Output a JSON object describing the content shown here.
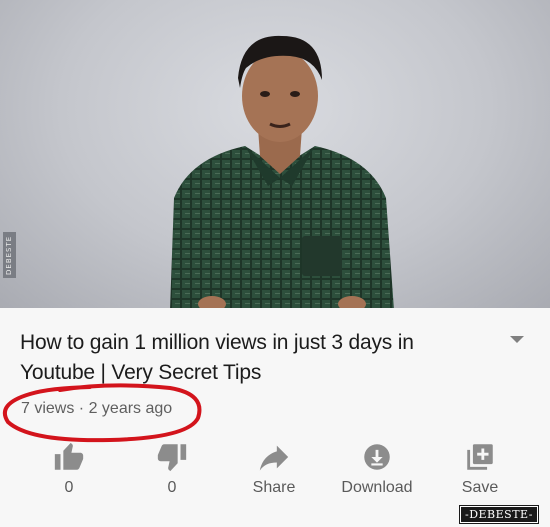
{
  "video": {
    "side_watermark": "DEBESTE"
  },
  "details": {
    "title": "How to gain 1 million views in just 3 days in Youtube | Very Secret Tips",
    "meta": "7 views · 2 years ago"
  },
  "actions": {
    "like_count": "0",
    "dislike_count": "0",
    "share_label": "Share",
    "download_label": "Download",
    "save_label": "Save"
  },
  "footer": {
    "watermark": "-DEBESTE-"
  },
  "colors": {
    "annotation_circle": "#d3141c",
    "icon_gray": "#8c8c8c"
  }
}
